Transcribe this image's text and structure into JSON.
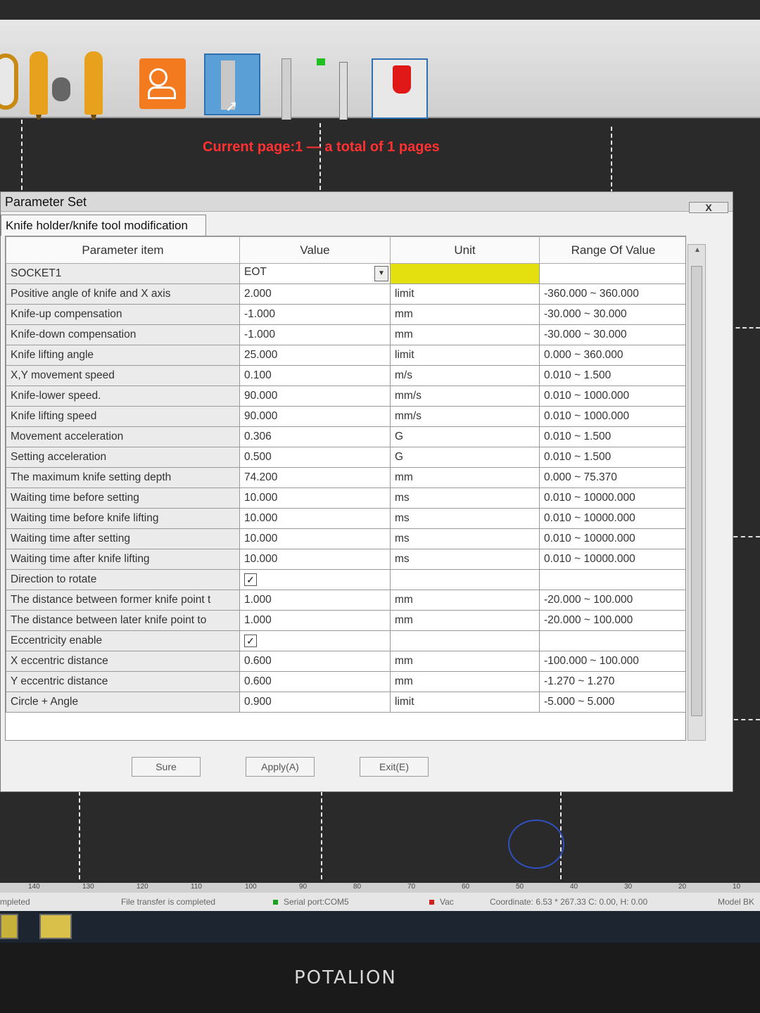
{
  "page_info": "Current page:1 — a total of 1 pages",
  "toolbar": {
    "tools": [
      "pen-tool-icon",
      "pen-user-icon",
      "pen-icon",
      "people-edit-icon",
      "knife-tool-icon",
      "pencil-icon",
      "green-marker-icon",
      "ruler-tool-icon",
      "red-marker-icon"
    ]
  },
  "dialog": {
    "title": "Parameter Set",
    "close_label": "X",
    "tab_label": "Knife holder/knife tool modification",
    "columns": [
      "Parameter item",
      "Value",
      "Unit",
      "Range Of Value"
    ],
    "rows": [
      {
        "name": "SOCKET1",
        "value": "EOT",
        "unit": "",
        "range": "",
        "type": "select"
      },
      {
        "name": "Positive angle of knife and X axis",
        "value": "2.000",
        "unit": "limit",
        "range": "-360.000 ~ 360.000"
      },
      {
        "name": "Knife-up compensation",
        "value": "-1.000",
        "unit": "mm",
        "range": "-30.000 ~ 30.000"
      },
      {
        "name": "Knife-down compensation",
        "value": "-1.000",
        "unit": "mm",
        "range": "-30.000 ~ 30.000"
      },
      {
        "name": "Knife lifting angle",
        "value": "25.000",
        "unit": "limit",
        "range": "0.000 ~ 360.000"
      },
      {
        "name": "X,Y movement speed",
        "value": "0.100",
        "unit": "m/s",
        "range": "0.010 ~ 1.500"
      },
      {
        "name": "Knife-lower speed.",
        "value": "90.000",
        "unit": "mm/s",
        "range": "0.010 ~ 1000.000"
      },
      {
        "name": "Knife lifting speed",
        "value": "90.000",
        "unit": "mm/s",
        "range": "0.010 ~ 1000.000"
      },
      {
        "name": "Movement acceleration",
        "value": "0.306",
        "unit": "G",
        "range": "0.010 ~ 1.500"
      },
      {
        "name": "Setting acceleration",
        "value": "0.500",
        "unit": "G",
        "range": "0.010 ~ 1.500"
      },
      {
        "name": "The maximum knife setting depth",
        "value": "74.200",
        "unit": "mm",
        "range": "0.000 ~ 75.370"
      },
      {
        "name": "Waiting time before setting",
        "value": "10.000",
        "unit": "ms",
        "range": "0.010 ~ 10000.000"
      },
      {
        "name": "Waiting time before knife lifting",
        "value": "10.000",
        "unit": "ms",
        "range": "0.010 ~ 10000.000"
      },
      {
        "name": "Waiting time after setting",
        "value": "10.000",
        "unit": "ms",
        "range": "0.010 ~ 10000.000"
      },
      {
        "name": "Waiting time after knife lifting",
        "value": "10.000",
        "unit": "ms",
        "range": "0.010 ~ 10000.000"
      },
      {
        "name": "Direction to rotate",
        "value": "✓",
        "unit": "",
        "range": "",
        "type": "checkbox"
      },
      {
        "name": "The distance between former knife point t",
        "value": "1.000",
        "unit": "mm",
        "range": "-20.000 ~ 100.000"
      },
      {
        "name": "The distance between later knife point to",
        "value": "1.000",
        "unit": "mm",
        "range": "-20.000 ~ 100.000"
      },
      {
        "name": "Eccentricity enable",
        "value": "✓",
        "unit": "",
        "range": "",
        "type": "checkbox"
      },
      {
        "name": "X eccentric distance",
        "value": "0.600",
        "unit": "mm",
        "range": "-100.000 ~ 100.000"
      },
      {
        "name": "Y eccentric distance",
        "value": "0.600",
        "unit": "mm",
        "range": "-1.270 ~ 1.270"
      },
      {
        "name": "Circle + Angle",
        "value": "0.900",
        "unit": "limit",
        "range": "-5.000 ~ 5.000"
      }
    ],
    "buttons": {
      "sure": "Sure",
      "apply": "Apply(A)",
      "exit": "Exit(E)"
    }
  },
  "ruler": [
    "140",
    "130",
    "120",
    "110",
    "100",
    "90",
    "80",
    "70",
    "60",
    "50",
    "40",
    "30",
    "20",
    "10"
  ],
  "status": {
    "left": "mpleted",
    "file": "File transfer is completed",
    "serial": "Serial port:COM5",
    "vac": "Vac",
    "coord": "Coordinate: 6.53 * 267.33 C: 0.00, H: 0.00",
    "model": "Model BK"
  },
  "brand": "POTALION",
  "colors": {
    "page_info": "#ff3030",
    "unit_highlight": "#e4e010",
    "toolbar_accent": "#f47a20"
  }
}
